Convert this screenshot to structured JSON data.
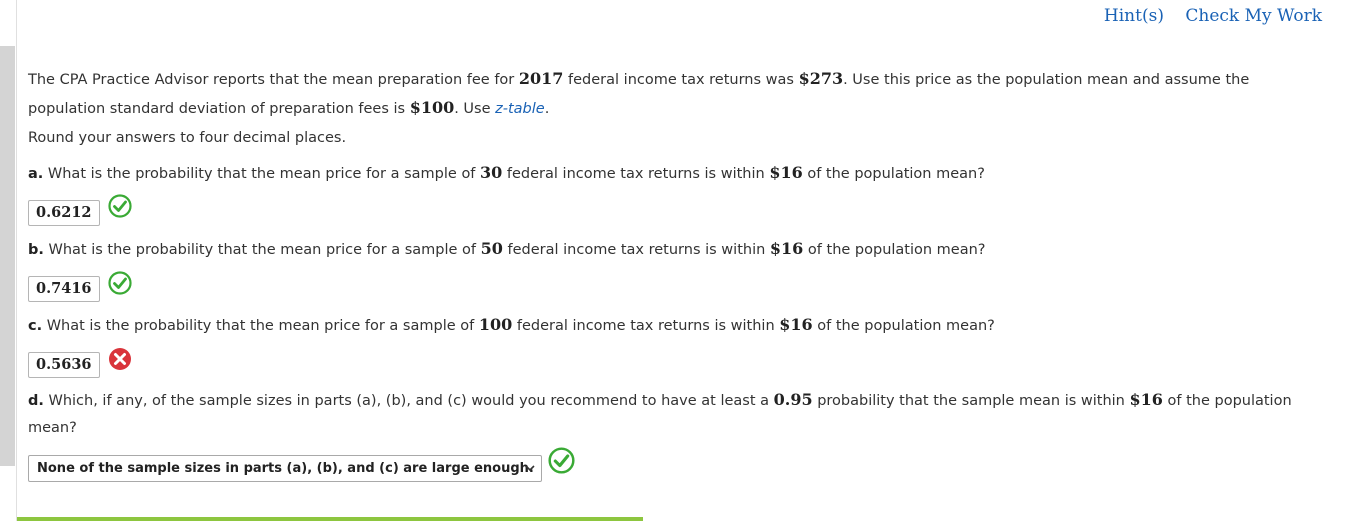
{
  "header": {
    "hints_label": "Hint(s)",
    "check_label": "Check My Work"
  },
  "intro": {
    "p1_a": "The CPA Practice Advisor reports that the mean preparation fee for ",
    "year": "2017",
    "p1_b": " federal income tax returns was ",
    "mean": "$273",
    "p1_c": ". Use this price as the population mean and assume the",
    "p2_a": "population standard deviation of preparation fees is ",
    "sd": "$100",
    "p2_b": ". Use ",
    "ztable_link": "z-table",
    "p2_c": ".",
    "round_note": "Round your answers to four decimal places."
  },
  "questions": [
    {
      "label": "a.",
      "t1": " What is the probability that the mean price for a sample of ",
      "n": "30",
      "t2": " federal income tax returns is within ",
      "d": "$16",
      "t3": " of the population mean?",
      "answer": "0.6212",
      "status": "correct"
    },
    {
      "label": "b.",
      "t1": " What is the probability that the mean price for a sample of ",
      "n": "50",
      "t2": " federal income tax returns is within ",
      "d": "$16",
      "t3": " of the population mean?",
      "answer": "0.7416",
      "status": "correct"
    },
    {
      "label": "c.",
      "t1": " What is the probability that the mean price for a sample of ",
      "n": "100",
      "t2": " federal income tax returns is within ",
      "d": "$16",
      "t3": " of the population mean?",
      "answer": "0.5636",
      "status": "incorrect"
    }
  ],
  "question_d": {
    "label": "d.",
    "t1": " Which, if any, of the sample sizes in parts (a), (b), and (c) would you recommend to have at least a ",
    "p": "0.95",
    "t2": " probability that the sample mean is within ",
    "d": "$16",
    "t3": " of the population",
    "t4": "mean?",
    "selected": "None of the sample sizes in parts (a), (b), and (c) are large enough.",
    "status": "correct"
  },
  "colors": {
    "link": "#1a62b5",
    "correct": "#3aaa35",
    "incorrect": "#d9343b",
    "progress": "#8dc63f"
  }
}
